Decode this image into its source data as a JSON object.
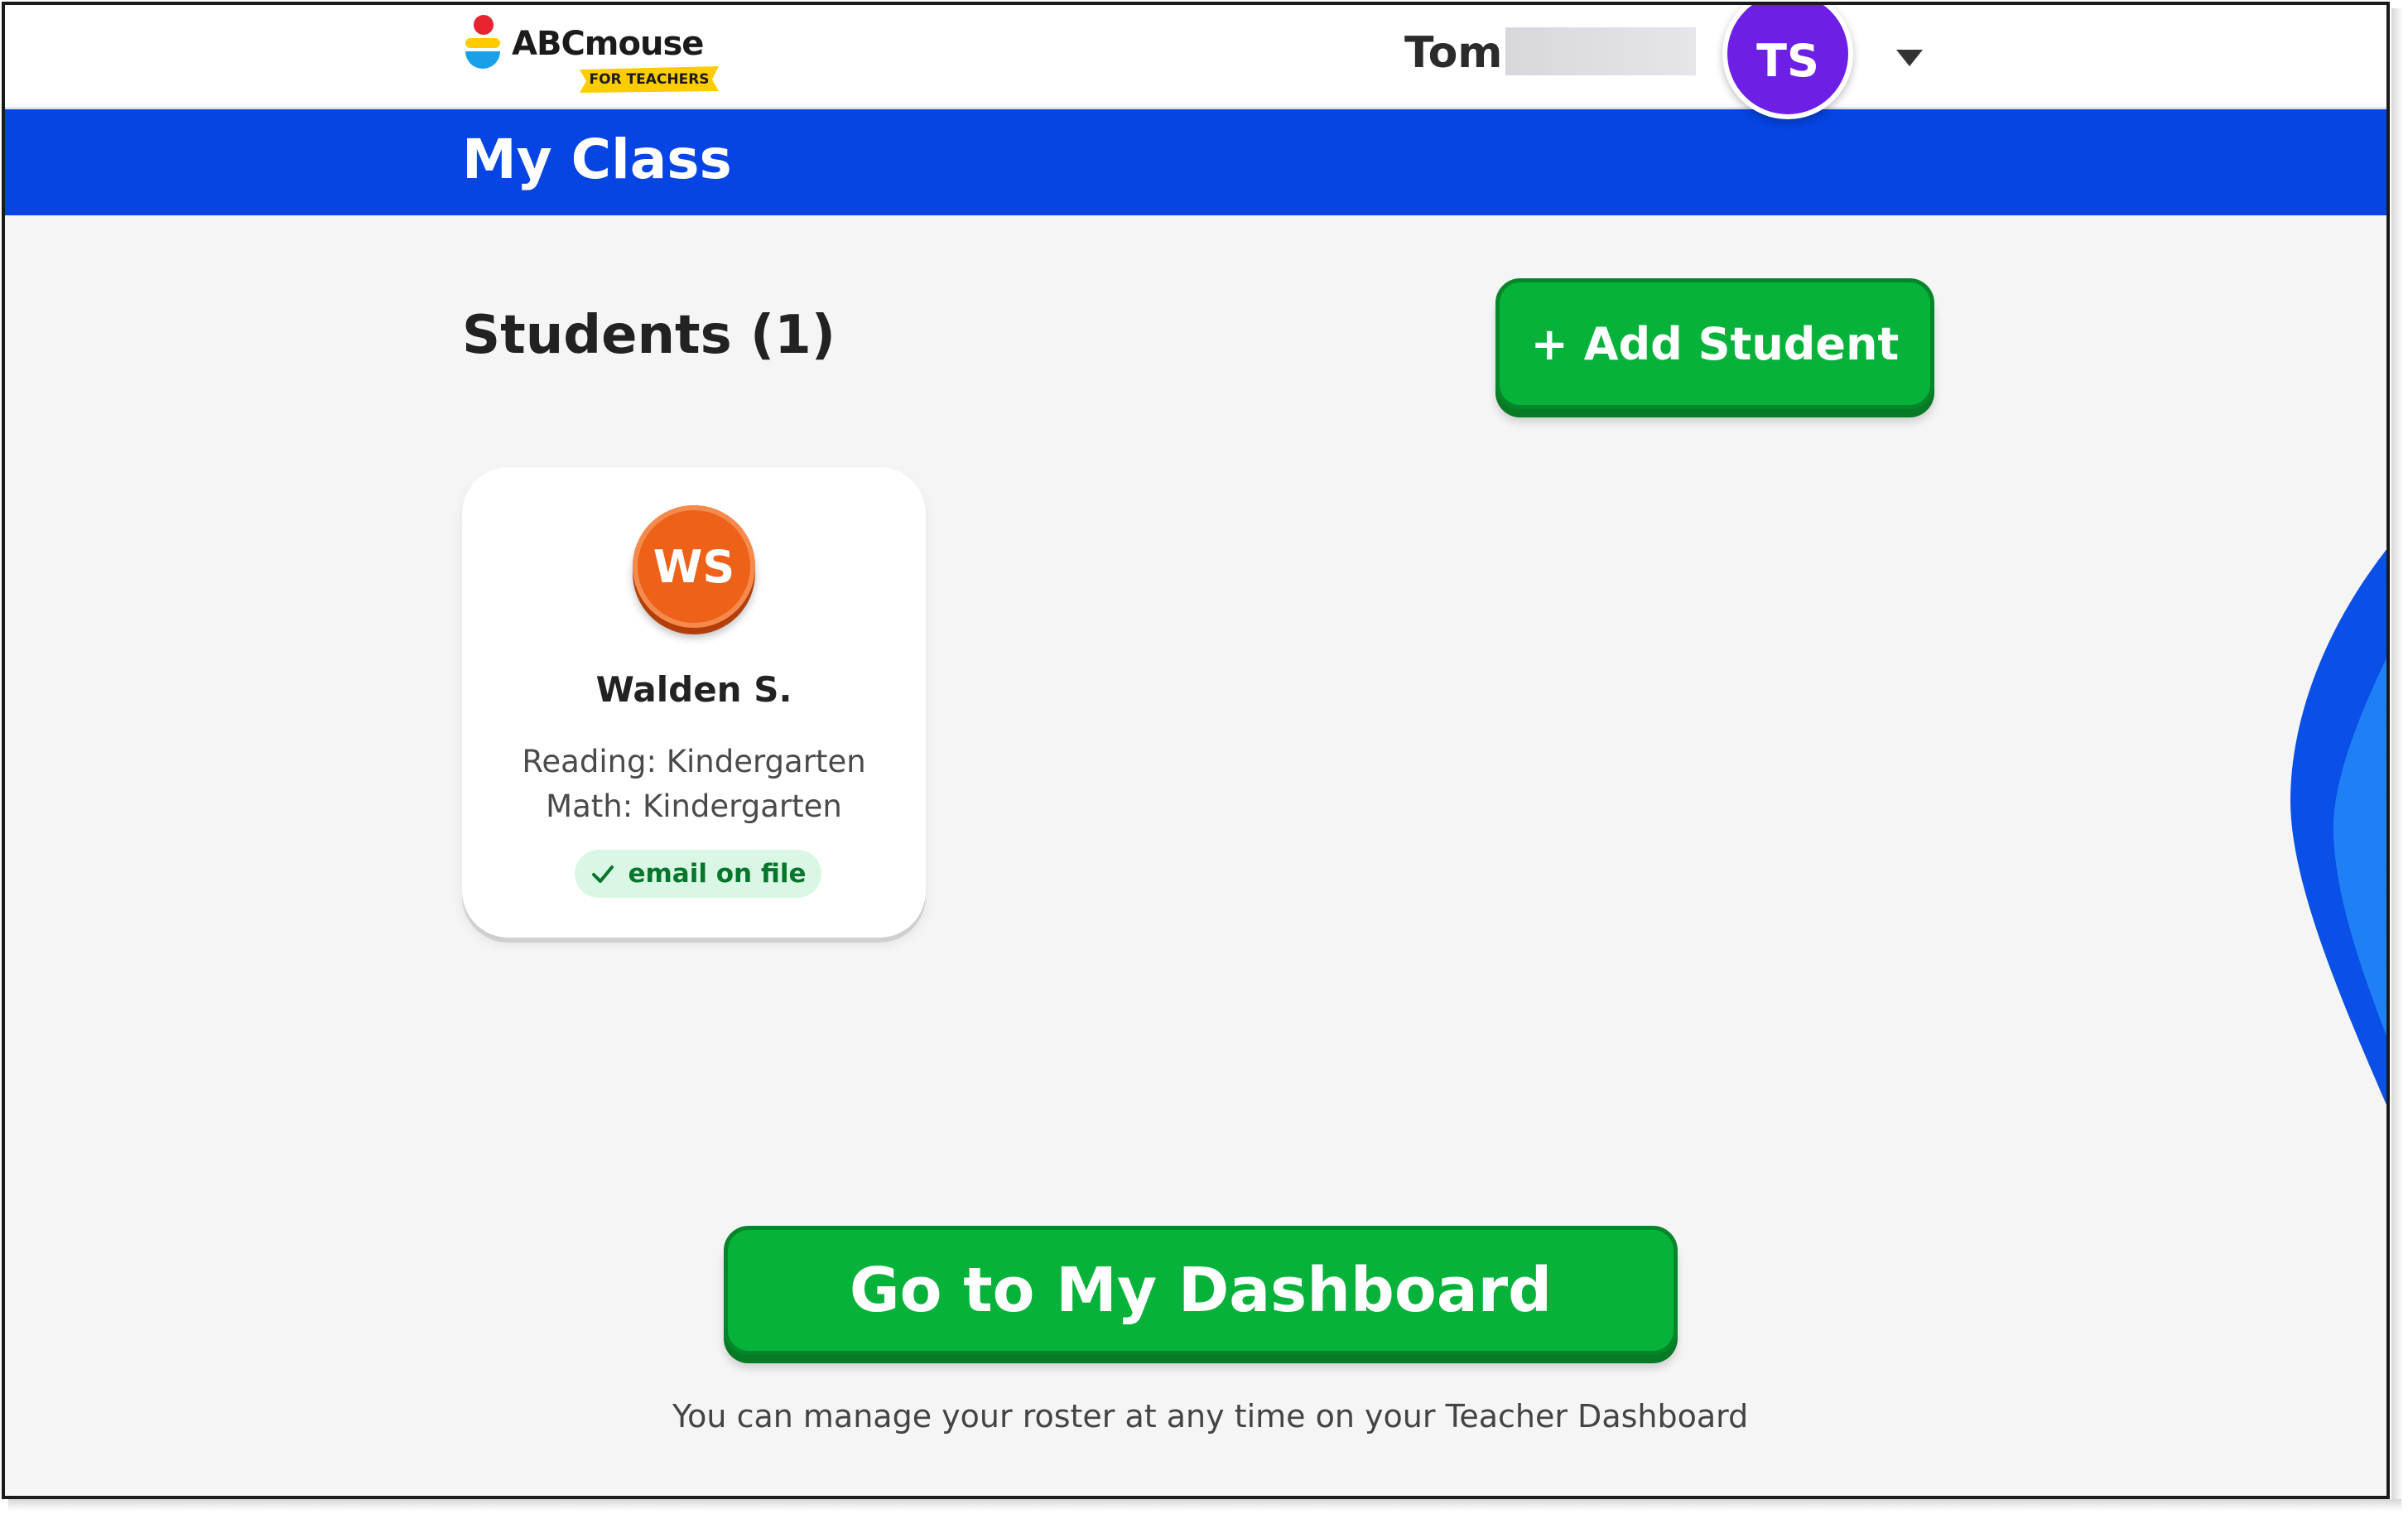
{
  "header": {
    "logo": {
      "brand_text": "ABCmouse",
      "ribbon_text": "FOR TEACHERS",
      "colors": {
        "red": "#e8232f",
        "yellow": "#ffcc00",
        "blue": "#1aa0e8"
      }
    },
    "user": {
      "first_name": "Tom",
      "avatar_initials": "TS",
      "avatar_color": "#6d1fe6",
      "menu_icon": "chevron-down-icon"
    }
  },
  "title_bar": {
    "title": "My Class",
    "color": "#0645e3"
  },
  "students_section": {
    "heading": "Students (1)",
    "add_button_label": "+ Add Student",
    "students": [
      {
        "initials": "WS",
        "name": "Walden S.",
        "reading": "Reading: Kindergarten",
        "math": "Math: Kindergarten",
        "email_status": "email on file",
        "email_status_icon": "check-icon",
        "avatar_color": "#ee6119"
      }
    ]
  },
  "footer": {
    "dashboard_button_label": "Go to My Dashboard",
    "note": "You can manage your roster at any time on your Teacher Dashboard"
  },
  "colors": {
    "button_green": "#06b23a",
    "page_background": "#f5f5f5",
    "decoration_blue": "#1a5cf0"
  }
}
